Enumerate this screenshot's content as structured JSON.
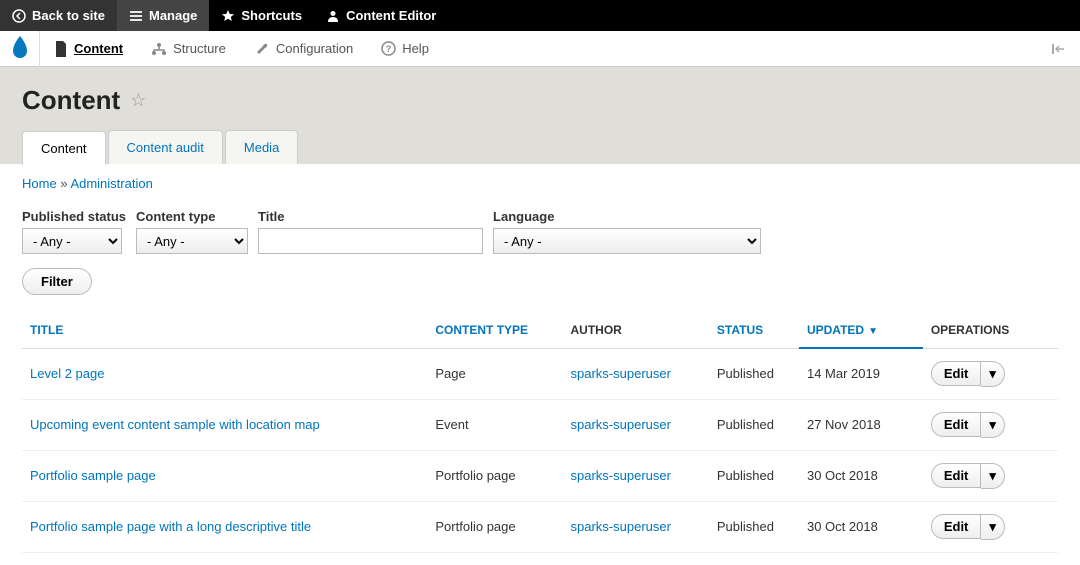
{
  "topbar": {
    "back": "Back to site",
    "manage": "Manage",
    "shortcuts": "Shortcuts",
    "user": "Content Editor"
  },
  "menubar": {
    "content": "Content",
    "structure": "Structure",
    "configuration": "Configuration",
    "help": "Help"
  },
  "page_title": "Content",
  "tabs": {
    "content": "Content",
    "audit": "Content audit",
    "media": "Media"
  },
  "breadcrumb": {
    "home": "Home",
    "admin": "Administration"
  },
  "filters": {
    "status_label": "Published status",
    "status_value": "- Any -",
    "type_label": "Content type",
    "type_value": "- Any -",
    "title_label": "Title",
    "title_value": "",
    "lang_label": "Language",
    "lang_value": "- Any -",
    "button": "Filter"
  },
  "table": {
    "headers": {
      "title": "TITLE",
      "type": "CONTENT TYPE",
      "author": "AUTHOR",
      "status": "STATUS",
      "updated": "UPDATED",
      "operations": "OPERATIONS"
    },
    "op_label": "Edit",
    "rows": [
      {
        "title": "Level 2 page",
        "type": "Page",
        "author": "sparks-superuser",
        "status": "Published",
        "updated": "14 Mar 2019"
      },
      {
        "title": "Upcoming event content sample with location map",
        "type": "Event",
        "author": "sparks-superuser",
        "status": "Published",
        "updated": "27 Nov 2018"
      },
      {
        "title": "Portfolio sample page",
        "type": "Portfolio page",
        "author": "sparks-superuser",
        "status": "Published",
        "updated": "30 Oct 2018"
      },
      {
        "title": "Portfolio sample page with a long descriptive title",
        "type": "Portfolio page",
        "author": "sparks-superuser",
        "status": "Published",
        "updated": "30 Oct 2018"
      }
    ]
  }
}
